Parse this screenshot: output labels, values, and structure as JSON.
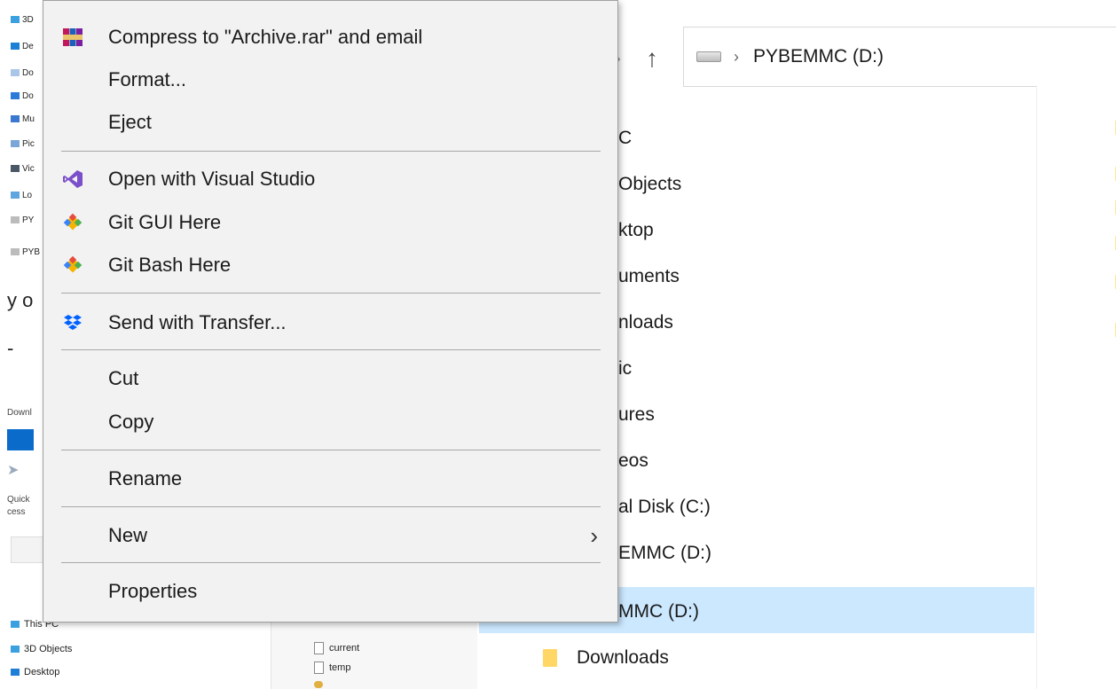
{
  "context_menu": {
    "items": [
      {
        "label": "Compress to \"Archive.rar\" and email",
        "icon": "winrar-icon"
      },
      {
        "label": "Format..."
      },
      {
        "label": "Eject"
      },
      {
        "label": "Open with Visual Studio",
        "icon": "visual-studio-icon"
      },
      {
        "label": "Git GUI Here",
        "icon": "git-icon"
      },
      {
        "label": "Git Bash Here",
        "icon": "git-icon"
      },
      {
        "label": "Send with Transfer...",
        "icon": "dropbox-icon"
      },
      {
        "label": "Cut"
      },
      {
        "label": "Copy"
      },
      {
        "label": "Rename"
      },
      {
        "label": "New",
        "submenu": true
      },
      {
        "label": "Properties"
      }
    ]
  },
  "explorer": {
    "address": "PYBEMMC (D:)",
    "tree": [
      "C",
      "Objects",
      "ktop",
      "uments",
      "nloads",
      "ic",
      "ures",
      "eos",
      "al Disk (C:)",
      "EMMC (D:)",
      "MMC (D:)",
      "Downloads"
    ]
  },
  "left_tree": [
    "3D",
    "De",
    "Do",
    "Do",
    "Mu",
    "Pic",
    "Vic",
    "Lo",
    "PY",
    "PYB"
  ],
  "left_fragments": {
    "text1": "y o",
    "text2": "-",
    "downl": "Downl",
    "quick": "Quick",
    "cess": "cess"
  },
  "bottom_tree": [
    "This PC",
    "3D Objects",
    "Desktop"
  ],
  "bottom_files": [
    "current",
    "temp"
  ],
  "colors": {
    "selected": "#cce8ff",
    "menu_bg": "#f2f2f2",
    "accent": "#0b6bcb"
  }
}
